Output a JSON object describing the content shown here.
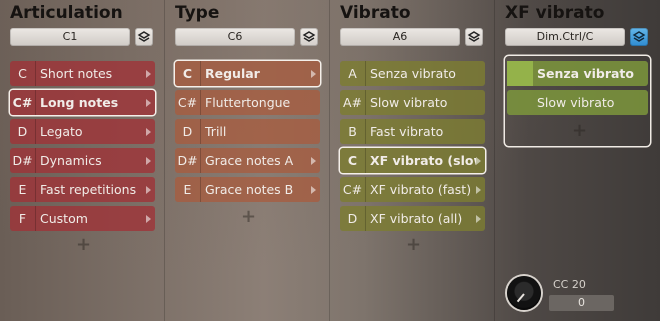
{
  "columns": [
    {
      "title": "Articulation",
      "key": "C1",
      "rows": [
        {
          "key": "C",
          "label": "Short notes"
        },
        {
          "key": "C#",
          "label": "Long notes"
        },
        {
          "key": "D",
          "label": "Legato"
        },
        {
          "key": "D#",
          "label": "Dynamics"
        },
        {
          "key": "E",
          "label": "Fast repetitions"
        },
        {
          "key": "F",
          "label": "Custom"
        }
      ],
      "add": "+"
    },
    {
      "title": "Type",
      "key": "C6",
      "rows": [
        {
          "key": "C",
          "label": "Regular"
        },
        {
          "key": "C#",
          "label": "Fluttertongue"
        },
        {
          "key": "D",
          "label": "Trill"
        },
        {
          "key": "D#",
          "label": "Grace notes A"
        },
        {
          "key": "E",
          "label": "Grace notes B"
        }
      ],
      "add": "+"
    },
    {
      "title": "Vibrato",
      "key": "A6",
      "rows": [
        {
          "key": "A",
          "label": "Senza vibrato"
        },
        {
          "key": "A#",
          "label": "Slow vibrato"
        },
        {
          "key": "B",
          "label": "Fast vibrato"
        },
        {
          "key": "C",
          "label": "XF vibrato (slow)"
        },
        {
          "key": "C#",
          "label": "XF vibrato (fast)"
        },
        {
          "key": "D",
          "label": "XF vibrato (all)"
        }
      ],
      "add": "+"
    },
    {
      "title": "XF vibrato",
      "key": "Dim.Ctrl/C",
      "rows": [
        {
          "key": "",
          "label": "Senza vibrato"
        },
        {
          "key": "",
          "label": "Slow vibrato"
        }
      ],
      "add": "+"
    }
  ],
  "cc": {
    "label": "CC 20",
    "value": "0"
  },
  "colors": {
    "articulation": "#a03237",
    "type": "#aa5a3c",
    "vibrato": "#7d7d32",
    "xf": "#7d963c",
    "selection": "#f5f0ea"
  },
  "icons": {
    "menu": "layers-icon"
  }
}
